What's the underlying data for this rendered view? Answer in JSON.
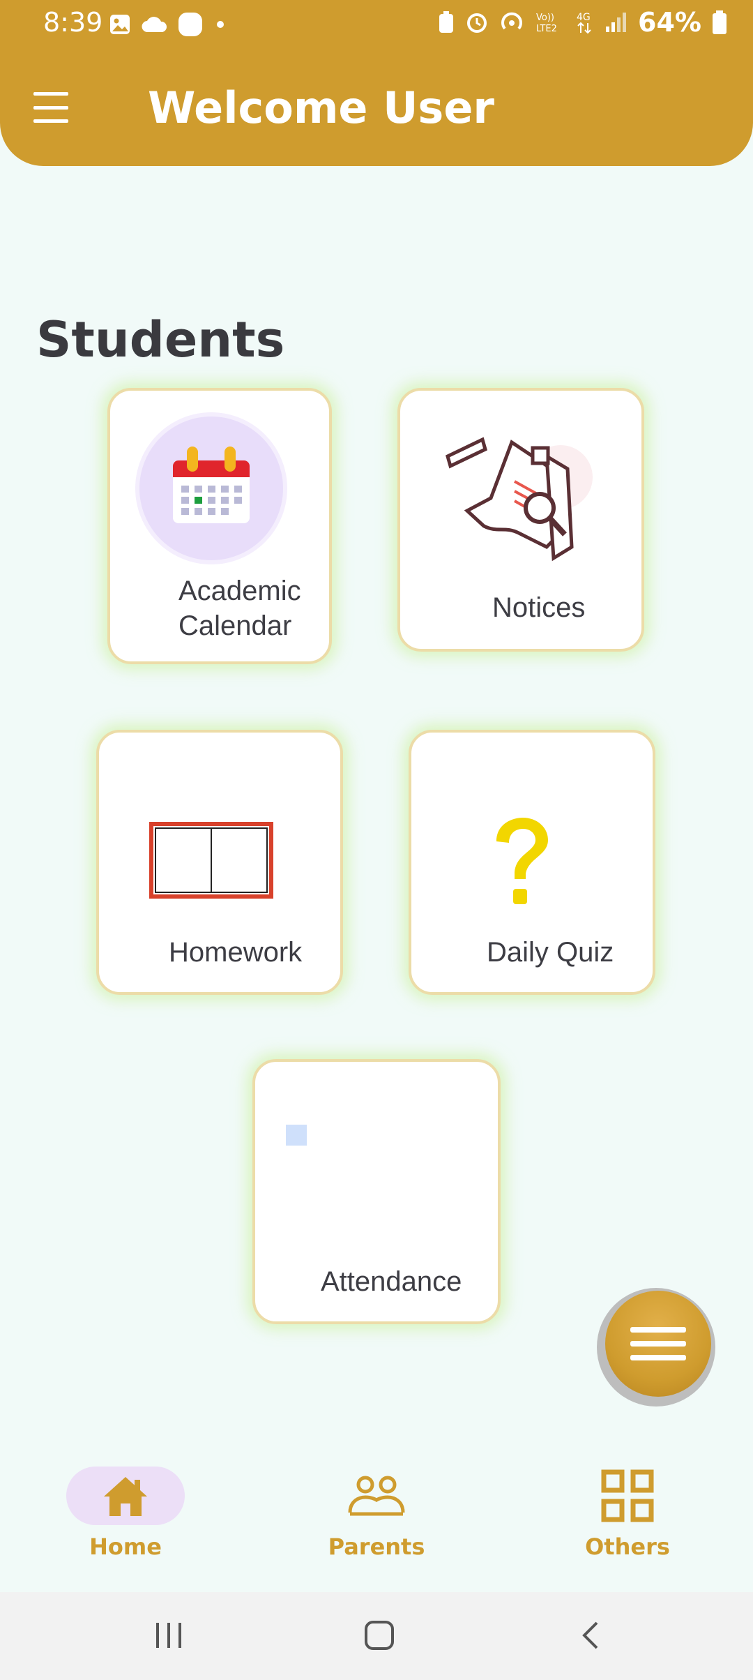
{
  "status_bar": {
    "time": "8:39",
    "battery": "64%",
    "network": "4G"
  },
  "header": {
    "title": "Welcome User"
  },
  "section": {
    "title": "Students"
  },
  "cards": {
    "academic_calendar": "Academic Calendar",
    "notices": "Notices",
    "homework": "Homework",
    "daily_quiz": "Daily Quiz",
    "attendance": "Attendance"
  },
  "bottom_nav": {
    "home": "Home",
    "parents": "Parents",
    "others": "Others"
  },
  "colors": {
    "brand": "#cf9c2e",
    "background": "#f1faf8",
    "active_pill": "#ecdff7",
    "card_border": "#ecdca8"
  }
}
